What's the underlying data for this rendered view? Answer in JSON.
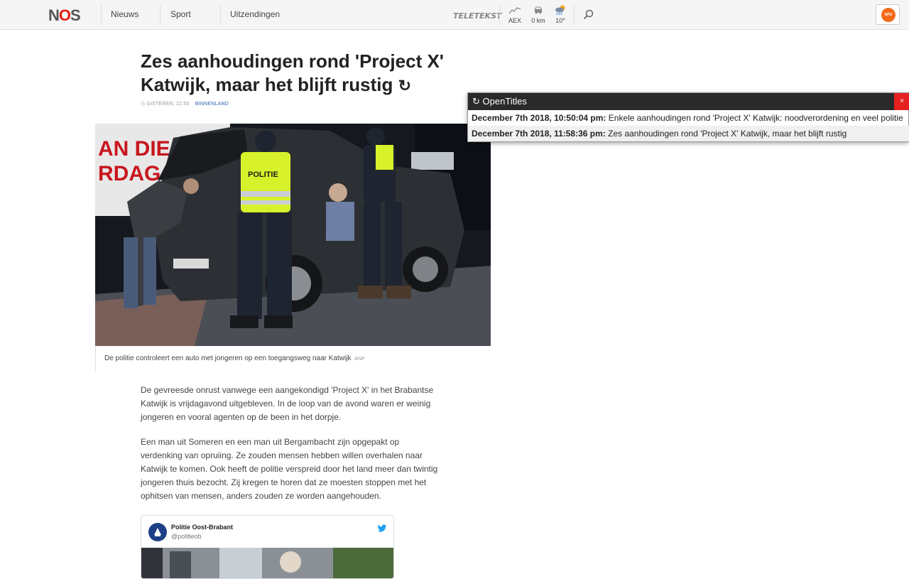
{
  "nav": {
    "logo_n": "N",
    "logo_o": "O",
    "logo_s": "S",
    "items": [
      "Nieuws",
      "Sport",
      "Uitzendingen"
    ],
    "teletekst": "TELETEKST",
    "widgets": [
      {
        "icon": "chart-icon",
        "label": "AEX"
      },
      {
        "icon": "car-icon",
        "label": "0 km"
      },
      {
        "icon": "weather-icon",
        "label": "10°"
      }
    ],
    "npo_label": "NPO"
  },
  "article": {
    "title": "Zes aanhoudingen rond 'Project X' Katwijk, maar het blijft rustig",
    "title_icon": "↻",
    "meta_time": "GISTEREN, 22:50",
    "meta_category": "BINNENLAND",
    "image_banner": "AN DIE S   ME\nRDAG DEA",
    "police_label": "POLITIE",
    "caption": "De politie controleert een auto met jongeren op een toegangsweg naar Katwijk",
    "caption_credit": "ANP",
    "paragraphs": [
      "De gevreesde onrust vanwege een aangekondigd 'Project X' in het Brabantse Katwijk is vrijdagavond uitgebleven. In de loop van de avond waren er weinig jongeren en vooral agenten op de been in het dorpje.",
      "Een man uit Someren en een man uit Bergambacht zijn opgepakt op verdenking van opruiing. Ze zouden mensen hebben willen overhalen naar Katwijk te komen. Ook heeft de politie verspreid door het land meer dan twintig jongeren thuis bezocht. Zij kregen te horen dat ze moesten stoppen met het ophitsen van mensen, anders zouden ze worden aangehouden."
    ]
  },
  "tweet": {
    "name": "Politie Oost-Brabant",
    "handle": "@politieob"
  },
  "opentitles": {
    "title": "OpenTitles",
    "close": "×",
    "rows": [
      {
        "date": "December 7th 2018, 10:50:04 pm:",
        "text": "Enkele aanhoudingen rond 'Project X' Katwijk: noodverordening en veel politie"
      },
      {
        "date": "December 7th 2018, 11:58:36 pm:",
        "text": "Zes aanhoudingen rond 'Project X' Katwijk, maar het blijft rustig"
      }
    ]
  },
  "colors": {
    "nos_red": "#e61e14",
    "close_red": "#e52020",
    "link_blue": "#3060b0",
    "twitter_blue": "#1da1f2",
    "police_yellow": "#d7f22a"
  }
}
